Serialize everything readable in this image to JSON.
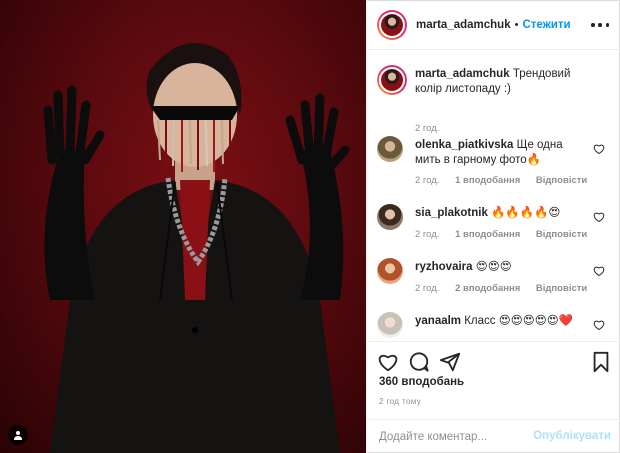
{
  "post": {
    "author": "marta_adamchuk",
    "follow_label": "Стежити",
    "dot": "•",
    "more_icon": "more-horizontal-icon"
  },
  "caption": {
    "username": "marta_adamchuk",
    "text": "Трендовий колір листопаду :)",
    "time": "2 год."
  },
  "comments": [
    {
      "username": "olenka_piatkivska",
      "text": "Ще одна мить в гарному фото🔥",
      "time": "2 год.",
      "likes": "1 вподобання",
      "reply": "Відповісти"
    },
    {
      "username": "sia_plakotnik",
      "text": "🔥🔥🔥🔥😍",
      "time": "2 год.",
      "likes": "1 вподобання",
      "reply": "Відповісти"
    },
    {
      "username": "ryzhovaira",
      "text": "😍😍😍",
      "time": "2 год.",
      "likes": "2 вподобання",
      "reply": "Відповісти"
    },
    {
      "username": "yanaalm",
      "text": "Класс 😍😍😍😍😍❤️",
      "time": "",
      "likes": "",
      "reply": ""
    }
  ],
  "actions": {
    "like_icon": "heart-icon",
    "comment_icon": "comment-icon",
    "share_icon": "share-icon",
    "save_icon": "bookmark-icon"
  },
  "likes_count": "360 вподобань",
  "post_time": "2 год тому",
  "add_comment": {
    "placeholder": "Додайте коментар...",
    "post_label": "Опублікувати"
  },
  "colors": {
    "link_blue": "#0095f6",
    "disabled_blue": "#b2dffc",
    "text": "#262626",
    "muted": "#8e8e8e",
    "photo_background": "#5a0a0e"
  }
}
